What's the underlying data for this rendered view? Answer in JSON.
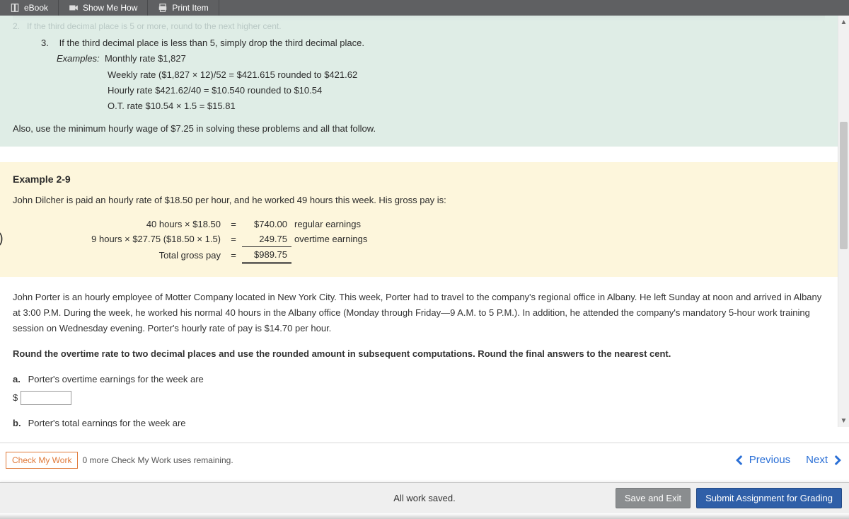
{
  "toolbar": {
    "ebook": "eBook",
    "show_me_how": "Show Me How",
    "print_item": "Print Item"
  },
  "green": {
    "cutoff_num": "2.",
    "cutoff_text": "If the third decimal place is 5 or more, round to the next higher cent.",
    "item3_num": "3.",
    "item3_text": "If the third decimal place is less than 5, simply drop the third decimal place.",
    "examples_label": "Examples:",
    "ex_a": "Monthly rate $1,827",
    "ex_b": "Weekly rate ($1,827 × 12)/52 = $421.615 rounded to $421.62",
    "ex_c": "Hourly rate $421.62/40 = $10.540 rounded to $10.54",
    "ex_d": "O.T. rate $10.54 × 1.5 = $15.81",
    "also": "Also, use the minimum hourly wage of $7.25 in solving these problems and all that follow."
  },
  "example": {
    "title": "Example 2-9",
    "lead": "John Dilcher is paid an hourly rate of $18.50 per hour, and he worked 49 hours this week. His gross pay is:",
    "rows": [
      {
        "lhs": "40 hours × $18.50",
        "eq": "=",
        "val": "$740.00",
        "lab": "regular earnings"
      },
      {
        "lhs": "9 hours × $27.75 ($18.50 × 1.5)",
        "eq": "=",
        "val": "249.75",
        "lab": "overtime earnings"
      },
      {
        "lhs": "Total gross pay",
        "eq": "=",
        "val": "$989.75",
        "lab": ""
      }
    ]
  },
  "problem": {
    "para": "John Porter is an hourly employee of Motter Company located in New York City. This week, Porter had to travel to the company's regional office in Albany. He left Sunday at noon and arrived in Albany at 3:00 P.M. During the week, he worked his normal 40 hours in the Albany office (Monday through Friday—9 A.M. to 5 P.M.). In addition, he attended the company's mandatory 5-hour work training session on Wednesday evening. Porter's hourly rate of pay is $14.70 per hour.",
    "instr": "Round the overtime rate to two decimal places and use the rounded amount in subsequent computations. Round the final answers to the nearest cent.",
    "qa_label": "a.",
    "qa_text": "Porter's overtime earnings for the week are",
    "qb_label": "b.",
    "qb_text": "Porter's total earnings for the week are",
    "dollar": "$",
    "ans_a": "",
    "ans_b": ""
  },
  "footer": {
    "check": "Check My Work",
    "remaining": "0 more Check My Work uses remaining.",
    "previous": "Previous",
    "next": "Next",
    "saved": "All work saved.",
    "save_exit": "Save and Exit",
    "submit": "Submit Assignment for Grading"
  }
}
